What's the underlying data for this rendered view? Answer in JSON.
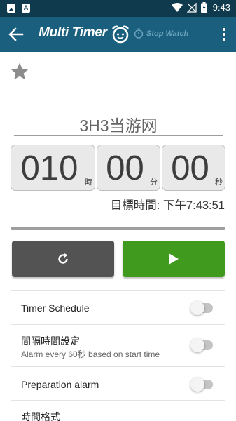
{
  "status_bar": {
    "time": "9:43",
    "left_icons": [
      "image-icon",
      "a-icon"
    ],
    "right_icons": [
      "wifi-icon",
      "no-signal-icon",
      "battery-icon"
    ]
  },
  "app_bar": {
    "title": "Multi Timer",
    "stopwatch_label": "Stop Watch",
    "color": "#1a5f7e"
  },
  "timer": {
    "name": "3H3当游网",
    "hours": "010",
    "hours_unit": "時",
    "minutes": "00",
    "minutes_unit": "分",
    "seconds": "00",
    "seconds_unit": "秒",
    "target_time": "目標時間: 下午7:43:51",
    "progress": 1.0
  },
  "buttons": {
    "reset_icon": "refresh-icon",
    "start_icon": "play-icon",
    "start_color": "#3f9a1d",
    "reset_color": "#535353"
  },
  "settings": [
    {
      "label": "Timer Schedule",
      "sub": "",
      "toggle": false
    },
    {
      "label": "間隔時間設定",
      "sub": "Alarm every 60秒 based on start time",
      "toggle": false
    },
    {
      "label": "Preparation alarm",
      "sub": "",
      "toggle": false
    },
    {
      "label": "時間格式",
      "sub": ""
    }
  ]
}
